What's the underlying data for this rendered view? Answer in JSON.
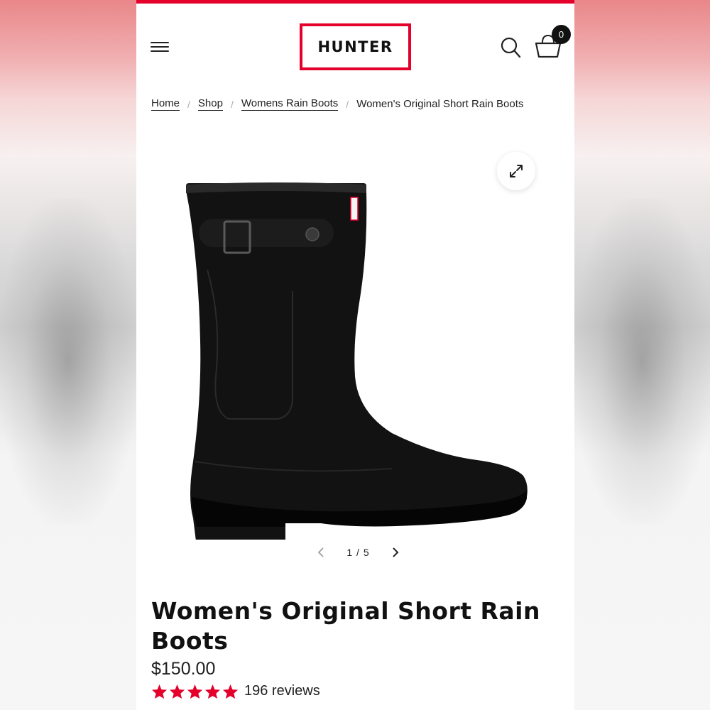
{
  "brand": {
    "logo_text": "HUNTER",
    "accent_color": "#e4002b"
  },
  "header": {
    "menu_icon": "hamburger-menu-icon",
    "search_icon": "search-icon",
    "cart_icon": "basket-icon",
    "cart_count": "0"
  },
  "breadcrumb": {
    "items": [
      "Home",
      "Shop",
      "Womens Rain Boots"
    ],
    "separator": "/",
    "current": "Women's Original Short Rain Boots"
  },
  "gallery": {
    "expand_icon": "expand-arrows-icon",
    "current_page": "1",
    "divider": "/",
    "total_pages": "5",
    "image": "black-rain-boot"
  },
  "product": {
    "title": "Women's Original Short Rain Boots",
    "price": "$150.00",
    "rating": 5,
    "rating_max": 5,
    "star_color": "#e4002b",
    "reviews": "196 reviews"
  }
}
